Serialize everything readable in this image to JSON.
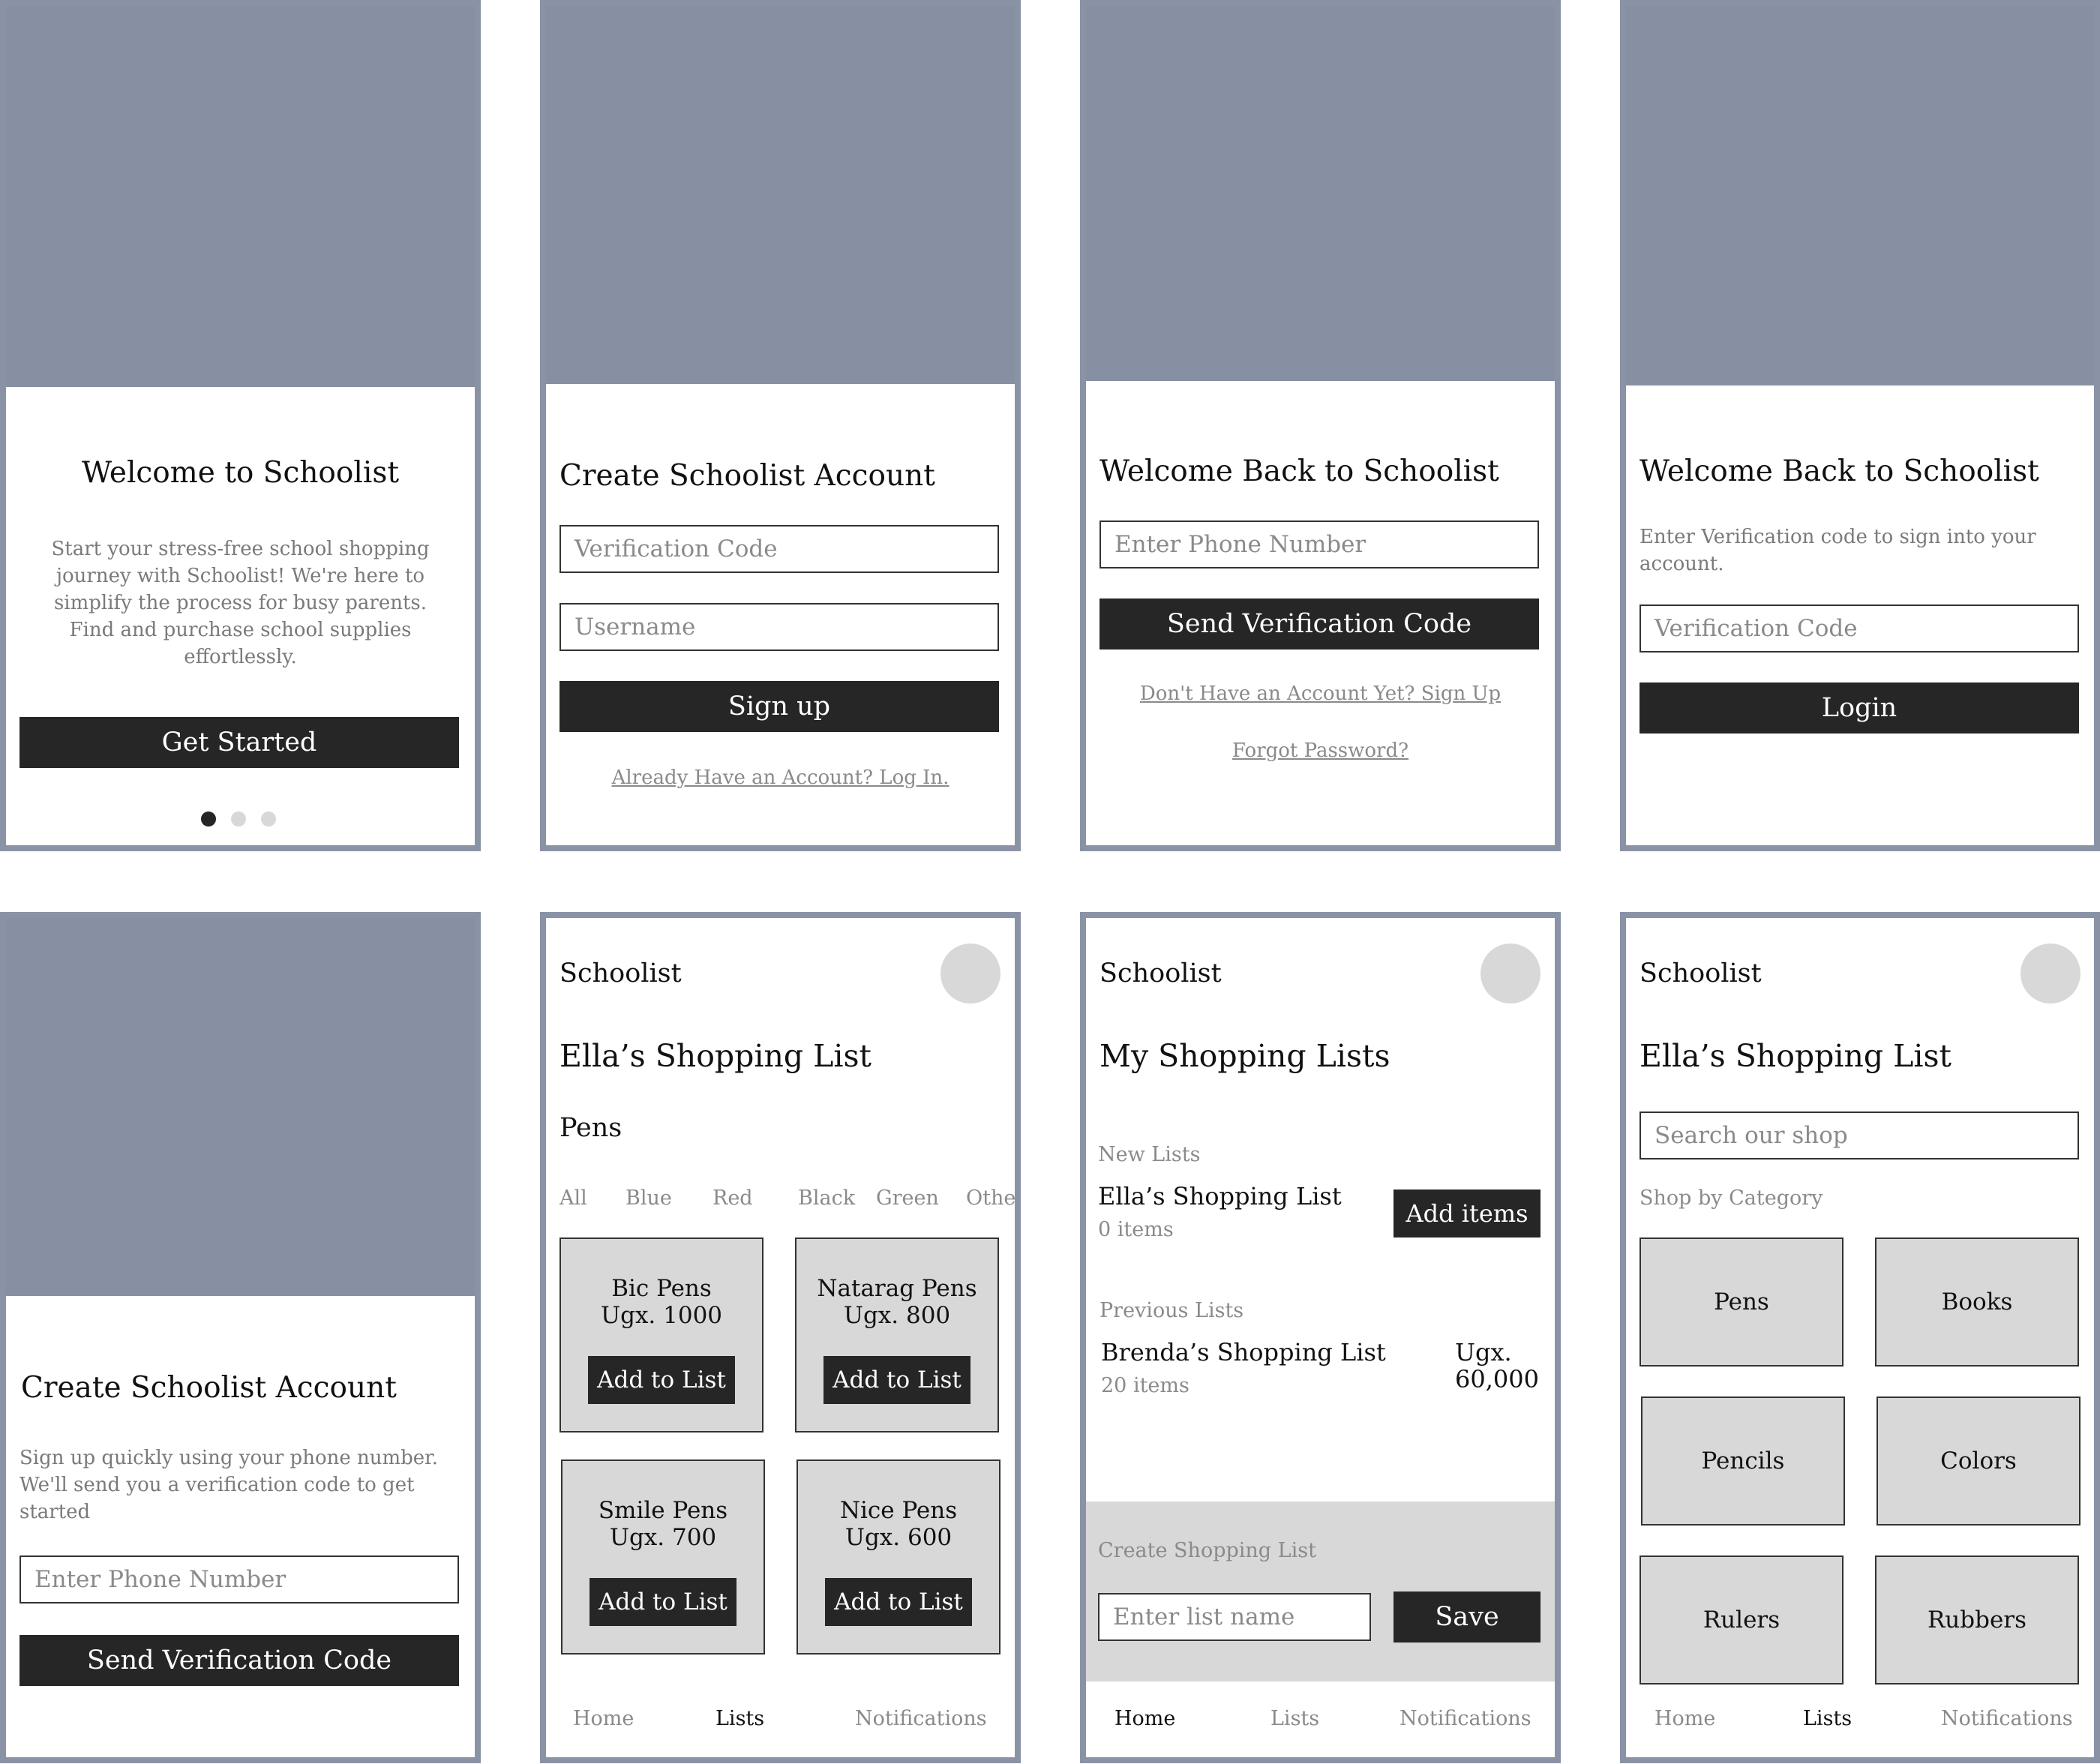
{
  "colors": {
    "hero": "#878fa2",
    "frame": "#8a93a6",
    "button": "#262626",
    "card": "#d8d8d8"
  },
  "s1": {
    "title": "Welcome to Schoolist",
    "body": "Start your stress-free school shopping journey with Schoolist! We're here to simplify the process for busy parents. Find and purchase school supplies effortlessly.",
    "button": "Get Started",
    "carousel": {
      "count": 3,
      "active": 1
    }
  },
  "s2": {
    "title": "Create Schoolist Account",
    "verification_placeholder": "Verification Code",
    "username_placeholder": "Username",
    "button": "Sign up",
    "link": "Already Have an Account? Log In."
  },
  "s3": {
    "title": "Welcome Back to Schoolist",
    "phone_placeholder": "Enter Phone Number",
    "button": "Send Verification Code",
    "signup_link": "Don't Have an Account Yet? Sign Up",
    "forgot_link": "Forgot Password?"
  },
  "s4": {
    "title": "Welcome Back to Schoolist",
    "body": "Enter Verification code to sign into your account.",
    "verification_placeholder": "Verification Code",
    "button": "Login"
  },
  "s5": {
    "title": "Create Schoolist Account",
    "body": "Sign up quickly using your phone number. We'll send you a verification code to get started",
    "phone_placeholder": "Enter Phone Number",
    "button": "Send Verification Code"
  },
  "s6": {
    "brand": "Schoolist",
    "title": "Ella’s Shopping List",
    "section": "Pens",
    "filters": [
      "All",
      "Blue",
      "Red",
      "Black",
      "Green",
      "Other"
    ],
    "products": [
      {
        "name": "Bic Pens",
        "price": "Ugx. 1000",
        "action": "Add to List"
      },
      {
        "name": "Natarag Pens",
        "price": "Ugx. 800",
        "action": "Add to List"
      },
      {
        "name": "Smile Pens",
        "price": "Ugx. 700",
        "action": "Add to List"
      },
      {
        "name": "Nice Pens",
        "price": "Ugx. 600",
        "action": "Add to List"
      }
    ],
    "nav": {
      "home": "Home",
      "lists": "Lists",
      "notifications": "Notifications",
      "active": "lists"
    }
  },
  "s7": {
    "brand": "Schoolist",
    "title": "My Shopping Lists",
    "new_label": "New Lists",
    "new_list": {
      "name": "Ella’s Shopping List",
      "count": "0 items",
      "action": "Add items"
    },
    "previous_label": "Previous Lists",
    "previous_list": {
      "name": "Brenda’s Shopping List",
      "count": "20 items",
      "amount_line1": "Ugx.",
      "amount_line2": "60,000"
    },
    "create_label": "Create Shopping List",
    "list_name_placeholder": "Enter list name",
    "save": "Save",
    "nav": {
      "home": "Home",
      "lists": "Lists",
      "notifications": "Notifications",
      "active": "home"
    }
  },
  "s8": {
    "brand": "Schoolist",
    "title": "Ella’s Shopping List",
    "search_placeholder": "Search our shop",
    "category_label": "Shop by Category",
    "categories": [
      "Pens",
      "Books",
      "Pencils",
      "Colors",
      "Rulers",
      "Rubbers"
    ],
    "nav": {
      "home": "Home",
      "lists": "Lists",
      "notifications": "Notifications",
      "active": "lists"
    }
  }
}
